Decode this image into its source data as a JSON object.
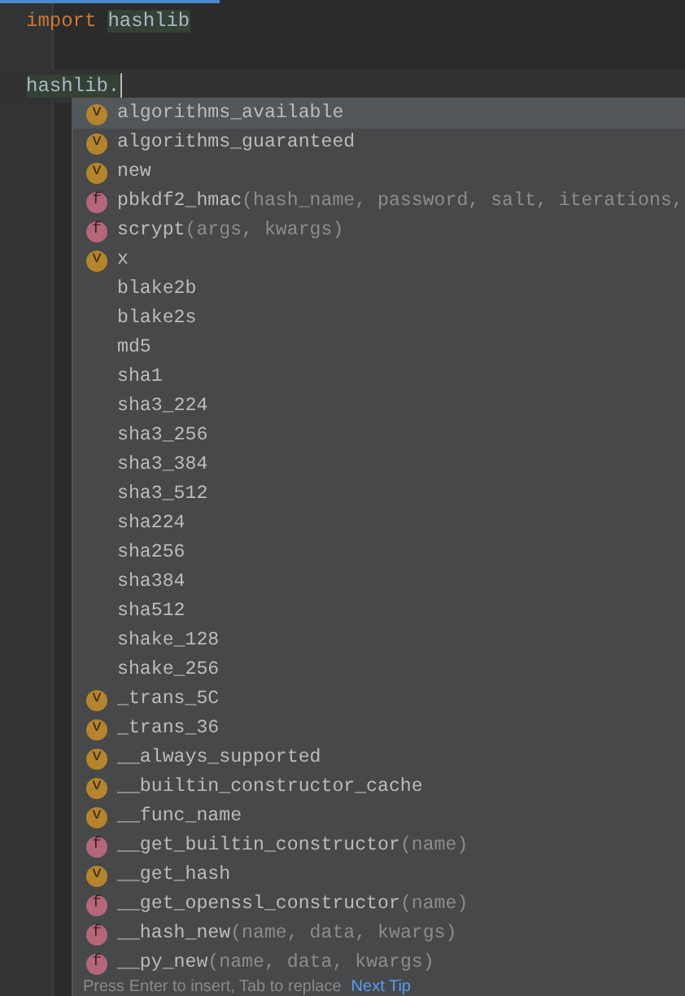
{
  "editor": {
    "lines": [
      {
        "kind": "code",
        "tokens": [
          {
            "kind": "keyword",
            "text": "import"
          },
          {
            "kind": "module",
            "text": "hashlib"
          }
        ]
      },
      {
        "kind": "blank"
      },
      {
        "kind": "code",
        "tokens": [
          {
            "kind": "module",
            "text": "hashlib."
          }
        ],
        "current": true,
        "caret": true
      }
    ]
  },
  "completion_popup": {
    "items": [
      {
        "kind": "variable",
        "badge": "v",
        "name": "algorithms_available",
        "selected": true
      },
      {
        "kind": "variable",
        "badge": "v",
        "name": "algorithms_guaranteed",
        "selected": false
      },
      {
        "kind": "variable",
        "badge": "v",
        "name": "new",
        "selected": false
      },
      {
        "kind": "function",
        "badge": "f",
        "name": "pbkdf2_hmac",
        "params": "(hash_name, password, salt, iterations,",
        "selected": false
      },
      {
        "kind": "function",
        "badge": "f",
        "name": "scrypt",
        "params": "(args, kwargs)",
        "selected": false
      },
      {
        "kind": "variable",
        "badge": "v",
        "name": "x",
        "selected": false
      },
      {
        "kind": "plain",
        "name": "blake2b",
        "selected": false
      },
      {
        "kind": "plain",
        "name": "blake2s",
        "selected": false
      },
      {
        "kind": "plain",
        "name": "md5",
        "selected": false
      },
      {
        "kind": "plain",
        "name": "sha1",
        "selected": false
      },
      {
        "kind": "plain",
        "name": "sha3_224",
        "selected": false
      },
      {
        "kind": "plain",
        "name": "sha3_256",
        "selected": false
      },
      {
        "kind": "plain",
        "name": "sha3_384",
        "selected": false
      },
      {
        "kind": "plain",
        "name": "sha3_512",
        "selected": false
      },
      {
        "kind": "plain",
        "name": "sha224",
        "selected": false
      },
      {
        "kind": "plain",
        "name": "sha256",
        "selected": false
      },
      {
        "kind": "plain",
        "name": "sha384",
        "selected": false
      },
      {
        "kind": "plain",
        "name": "sha512",
        "selected": false
      },
      {
        "kind": "plain",
        "name": "shake_128",
        "selected": false
      },
      {
        "kind": "plain",
        "name": "shake_256",
        "selected": false
      },
      {
        "kind": "variable",
        "badge": "v",
        "name": "_trans_5C",
        "selected": false
      },
      {
        "kind": "variable",
        "badge": "v",
        "name": "_trans_36",
        "selected": false
      },
      {
        "kind": "variable",
        "badge": "v",
        "name": "__always_supported",
        "selected": false
      },
      {
        "kind": "variable",
        "badge": "v",
        "name": "__builtin_constructor_cache",
        "selected": false
      },
      {
        "kind": "variable",
        "badge": "v",
        "name": "__func_name",
        "selected": false
      },
      {
        "kind": "function",
        "badge": "f",
        "name": "__get_builtin_constructor",
        "params": "(name)",
        "selected": false
      },
      {
        "kind": "variable",
        "badge": "v",
        "name": "__get_hash",
        "selected": false
      },
      {
        "kind": "function",
        "badge": "f",
        "name": "__get_openssl_constructor",
        "params": "(name)",
        "selected": false
      },
      {
        "kind": "function",
        "badge": "f",
        "name": "__hash_new",
        "params": "(name, data, kwargs)",
        "selected": false
      },
      {
        "kind": "function",
        "badge": "f",
        "name": "__py_new",
        "params": "(name, data, kwargs)",
        "selected": false
      }
    ],
    "footer": {
      "hint": "Press Enter to insert, Tab to replace",
      "link": "Next Tip"
    }
  }
}
